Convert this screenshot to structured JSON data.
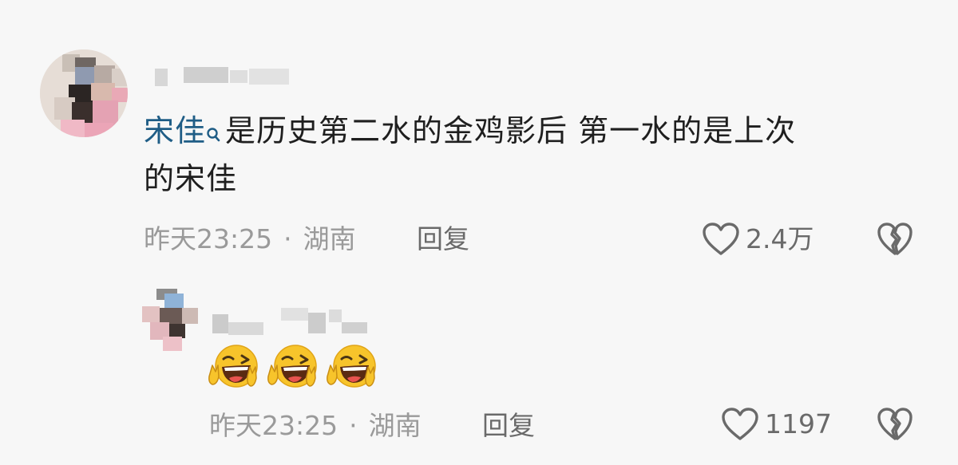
{
  "comment": {
    "mention": "宋佳",
    "text_line1": "是历史第二水的金鸡影后  第一水的是上次",
    "text_line2": "的宋佳",
    "date": "昨天23:25",
    "separator": "·",
    "location": "湖南",
    "reply_label": "回复",
    "like_count": "2.4万"
  },
  "reply": {
    "emojis": [
      "grinning-wink-victory-emoji",
      "grinning-wink-victory-emoji",
      "grinning-wink-victory-emoji"
    ],
    "date": "昨天23:25",
    "separator": "·",
    "location": "湖南",
    "reply_label": "回复",
    "like_count": "1197"
  },
  "colors": {
    "background": "#f7f7f7",
    "text": "#1f1f1f",
    "mention": "#1f5d86",
    "meta": "#9a9a9a",
    "action": "#6a6a6a",
    "emoji_face": "#f7c42b"
  }
}
